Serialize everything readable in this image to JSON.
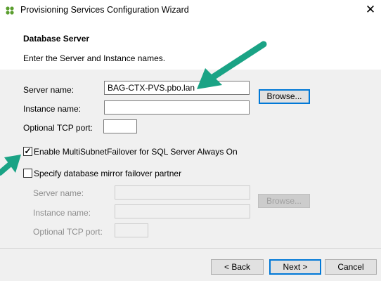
{
  "window": {
    "title": "Provisioning Services Configuration Wizard",
    "close_glyph": "✕",
    "app_icon": "citrix-flower-icon"
  },
  "header": {
    "heading": "Database Server",
    "subheading": "Enter the Server and Instance names."
  },
  "primary": {
    "server_label": "Server name:",
    "server_value": "BAG-CTX-PVS.pbo.lan",
    "instance_label": "Instance name:",
    "instance_value": "",
    "tcp_label": "Optional TCP port:",
    "tcp_value": "",
    "browse_label": "Browse..."
  },
  "options": {
    "multisubnet_label": "Enable MultiSubnetFailover for SQL Server Always On",
    "multisubnet_checked": true,
    "mirror_label": "Specify database mirror failover partner",
    "mirror_checked": false
  },
  "mirror": {
    "server_label": "Server name:",
    "instance_label": "Instance name:",
    "tcp_label": "Optional TCP port:",
    "browse_label": "Browse..."
  },
  "footer": {
    "back_label": "< Back",
    "next_label": "Next >",
    "cancel_label": "Cancel"
  },
  "annotations": {
    "arrow_color": "#1aa385"
  }
}
